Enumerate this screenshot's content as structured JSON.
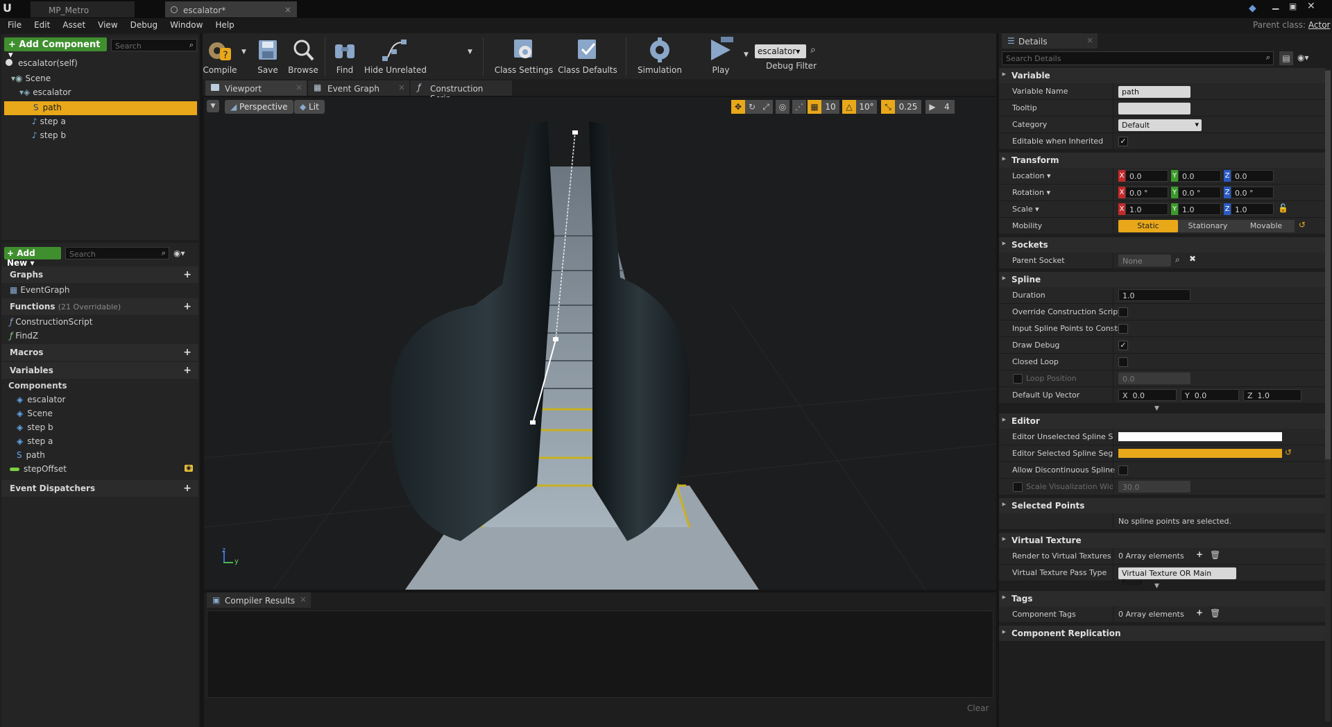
{
  "titlebar": {
    "tabs": [
      "MP_Metro",
      "escalator*"
    ],
    "parent_class_label": "Parent class:",
    "parent_class_value": "Actor"
  },
  "menu": [
    "File",
    "Edit",
    "Asset",
    "View",
    "Debug",
    "Window",
    "Help"
  ],
  "components": {
    "add_label": "+ Add Component ▾",
    "search_placeholder": "Search",
    "self_label": "escalator(self)",
    "tree": [
      "Scene",
      "escalator",
      "path",
      "step a",
      "step b"
    ]
  },
  "mybp": {
    "add_new_label": "+ Add New ▾",
    "search_placeholder": "Search",
    "graphs": "Graphs",
    "event_graph": "EventGraph",
    "functions": "Functions",
    "functions_note": "(21 Overridable)",
    "construction_script": "ConstructionScript",
    "findz": "FindZ",
    "macros": "Macros",
    "variables": "Variables",
    "components_cat": "Components",
    "var_items": [
      "escalator",
      "Scene",
      "step b",
      "step a",
      "path"
    ],
    "step_offset": "stepOffset",
    "event_dispatchers": "Event Dispatchers"
  },
  "toolbar": {
    "compile": "Compile",
    "save": "Save",
    "browse": "Browse",
    "find": "Find",
    "hide_unrelated": "Hide Unrelated",
    "class_settings": "Class Settings",
    "class_defaults": "Class Defaults",
    "simulation": "Simulation",
    "play": "Play",
    "debug_object": "escalator▾",
    "debug_filter": "Debug Filter"
  },
  "graph_tabs": [
    "Viewport",
    "Event Graph",
    "Construction Scrip"
  ],
  "viewport": {
    "perspective": "Perspective",
    "lit": "Lit",
    "grid_snap": "10",
    "rot_snap": "10°",
    "scale_snap": "0.25",
    "cam_speed": "4",
    "axes": {
      "z": "z",
      "y": "y"
    }
  },
  "compiler": {
    "tab": "Compiler Results",
    "clear": "Clear"
  },
  "details": {
    "tab": "Details",
    "search_placeholder": "Search Details",
    "variable": {
      "title": "Variable",
      "name_label": "Variable Name",
      "name_value": "path",
      "tooltip_label": "Tooltip",
      "tooltip_value": "",
      "category_label": "Category",
      "category_value": "Default",
      "editable_label": "Editable when Inherited"
    },
    "transform": {
      "title": "Transform",
      "location": "Location ▾",
      "rotation": "Rotation ▾",
      "scale": "Scale ▾",
      "mobility": "Mobility",
      "loc": [
        "0.0",
        "0.0",
        "0.0"
      ],
      "rot": [
        "0.0 °",
        "0.0 °",
        "0.0 °"
      ],
      "scl": [
        "1.0",
        "1.0",
        "1.0"
      ],
      "static": "Static",
      "stationary": "Stationary",
      "movable": "Movable"
    },
    "sockets": {
      "title": "Sockets",
      "parent_label": "Parent Socket",
      "parent_value": "None"
    },
    "spline": {
      "title": "Spline",
      "duration_label": "Duration",
      "duration_value": "1.0",
      "override": "Override Construction Script",
      "input_points": "Input Spline Points to Construction Script",
      "draw_debug": "Draw Debug",
      "closed_loop": "Closed Loop",
      "loop_position": "Loop Position",
      "loop_value": "0.0",
      "up_vector": "Default Up Vector",
      "up": [
        "0.0",
        "0.0",
        "1.0"
      ]
    },
    "editor": {
      "title": "Editor",
      "unselected": "Editor Unselected Spline Segment Color",
      "selected": "Editor Selected Spline Segment Color",
      "discontinuous": "Allow Discontinuous Spline",
      "scale_vis": "Scale Visualization Width",
      "scale_vis_value": "30.0"
    },
    "selected_points": {
      "title": "Selected Points",
      "message": "No spline points are selected."
    },
    "virtual_texture": {
      "title": "Virtual Texture",
      "render_label": "Render to Virtual Textures",
      "render_value": "0 Array elements",
      "pass_label": "Virtual Texture Pass Type",
      "pass_value": "Virtual Texture OR Main Pass▾"
    },
    "tags": {
      "title": "Tags",
      "component_tags": "Component Tags",
      "value": "0 Array elements"
    },
    "replication": {
      "title": "Component Replication"
    }
  },
  "colors": {
    "accent": "#e8a81a",
    "unselected_spline": "#ffffff",
    "selected_spline": "#e8a81a",
    "green_button": "#3f8f2f"
  }
}
